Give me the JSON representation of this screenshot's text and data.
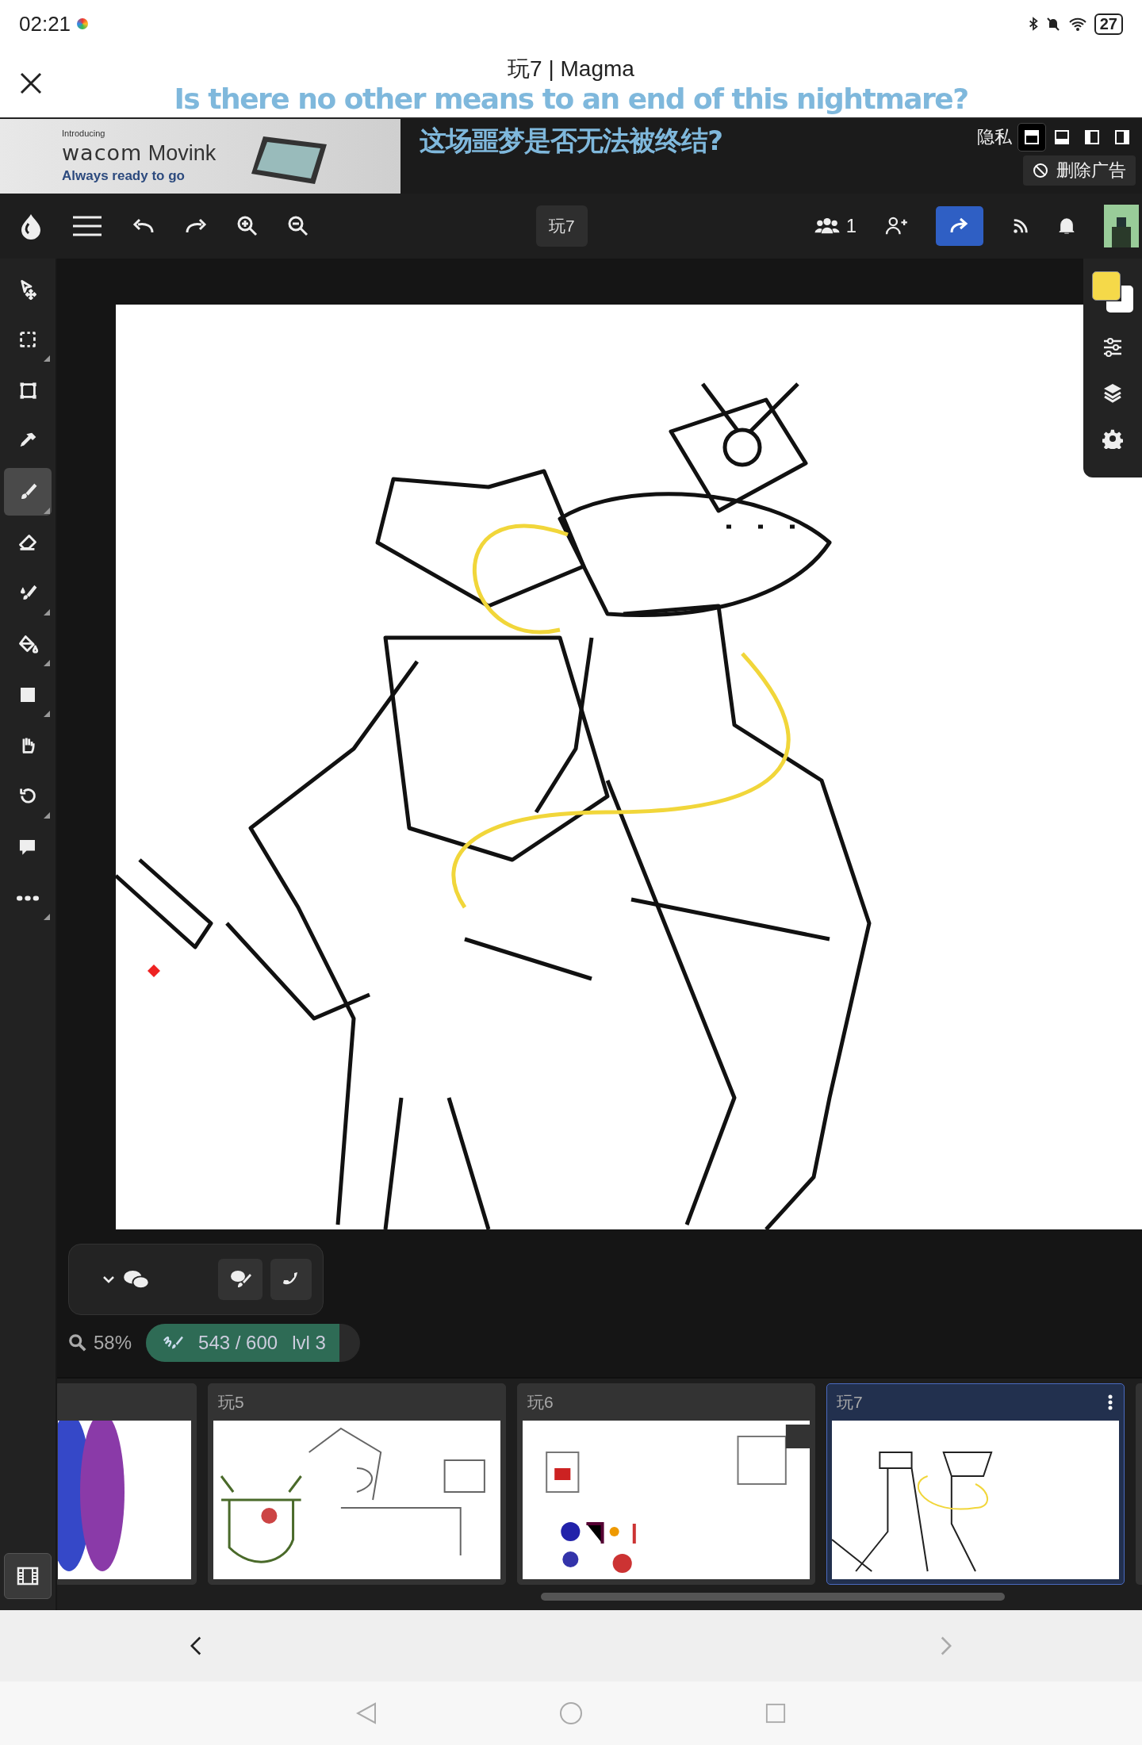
{
  "status_bar": {
    "time": "02:21",
    "battery": "27"
  },
  "header": {
    "title": "玩7 | Magma"
  },
  "subtitles": [
    "Is there no other means to an end of this nightmare?",
    "这场噩梦是否无法被终结?"
  ],
  "ad": {
    "intro": "Introducing",
    "brand": "wacom",
    "product": "Movink",
    "tagline": "Always ready to go",
    "privacy": "隐私",
    "remove": "删除广告",
    "layouts": [
      {
        "kind": "top",
        "selected": true
      },
      {
        "kind": "bottom",
        "selected": false
      },
      {
        "kind": "left",
        "selected": false
      },
      {
        "kind": "right",
        "selected": false
      }
    ]
  },
  "toolbar": {
    "document": "玩7",
    "users": "1"
  },
  "tools": [
    {
      "kind": "move",
      "selected": false,
      "has_options": false
    },
    {
      "kind": "select",
      "selected": false,
      "has_options": true
    },
    {
      "kind": "transform",
      "selected": false,
      "has_options": false
    },
    {
      "kind": "eyedropper",
      "selected": false,
      "has_options": false
    },
    {
      "kind": "brush",
      "selected": true,
      "has_options": true
    },
    {
      "kind": "eraser",
      "selected": false,
      "has_options": false
    },
    {
      "kind": "smudge",
      "selected": false,
      "has_options": true
    },
    {
      "kind": "fill",
      "selected": false,
      "has_options": true
    },
    {
      "kind": "shape",
      "selected": false,
      "has_options": true
    },
    {
      "kind": "hand",
      "selected": false,
      "has_options": false
    },
    {
      "kind": "rotate",
      "selected": false,
      "has_options": true
    },
    {
      "kind": "comment",
      "selected": false,
      "has_options": false
    },
    {
      "kind": "more",
      "selected": false,
      "has_options": true
    }
  ],
  "colors": [
    {
      "kind": "secondary",
      "color": "#ffffff"
    },
    {
      "kind": "primary",
      "color": "#f5d949"
    }
  ],
  "stats": {
    "zoom": "58%",
    "progress": "543 / 600",
    "level_text": "lvl 3",
    "level": 0.905
  },
  "pages": [
    {
      "selected": false,
      "kind": "color"
    },
    {
      "label": "玩5",
      "selected": false,
      "kind": "sketch"
    },
    {
      "label": "玩6",
      "selected": false,
      "kind": "doodles"
    },
    {
      "label": "玩7",
      "selected": true,
      "kind": "current"
    }
  ]
}
